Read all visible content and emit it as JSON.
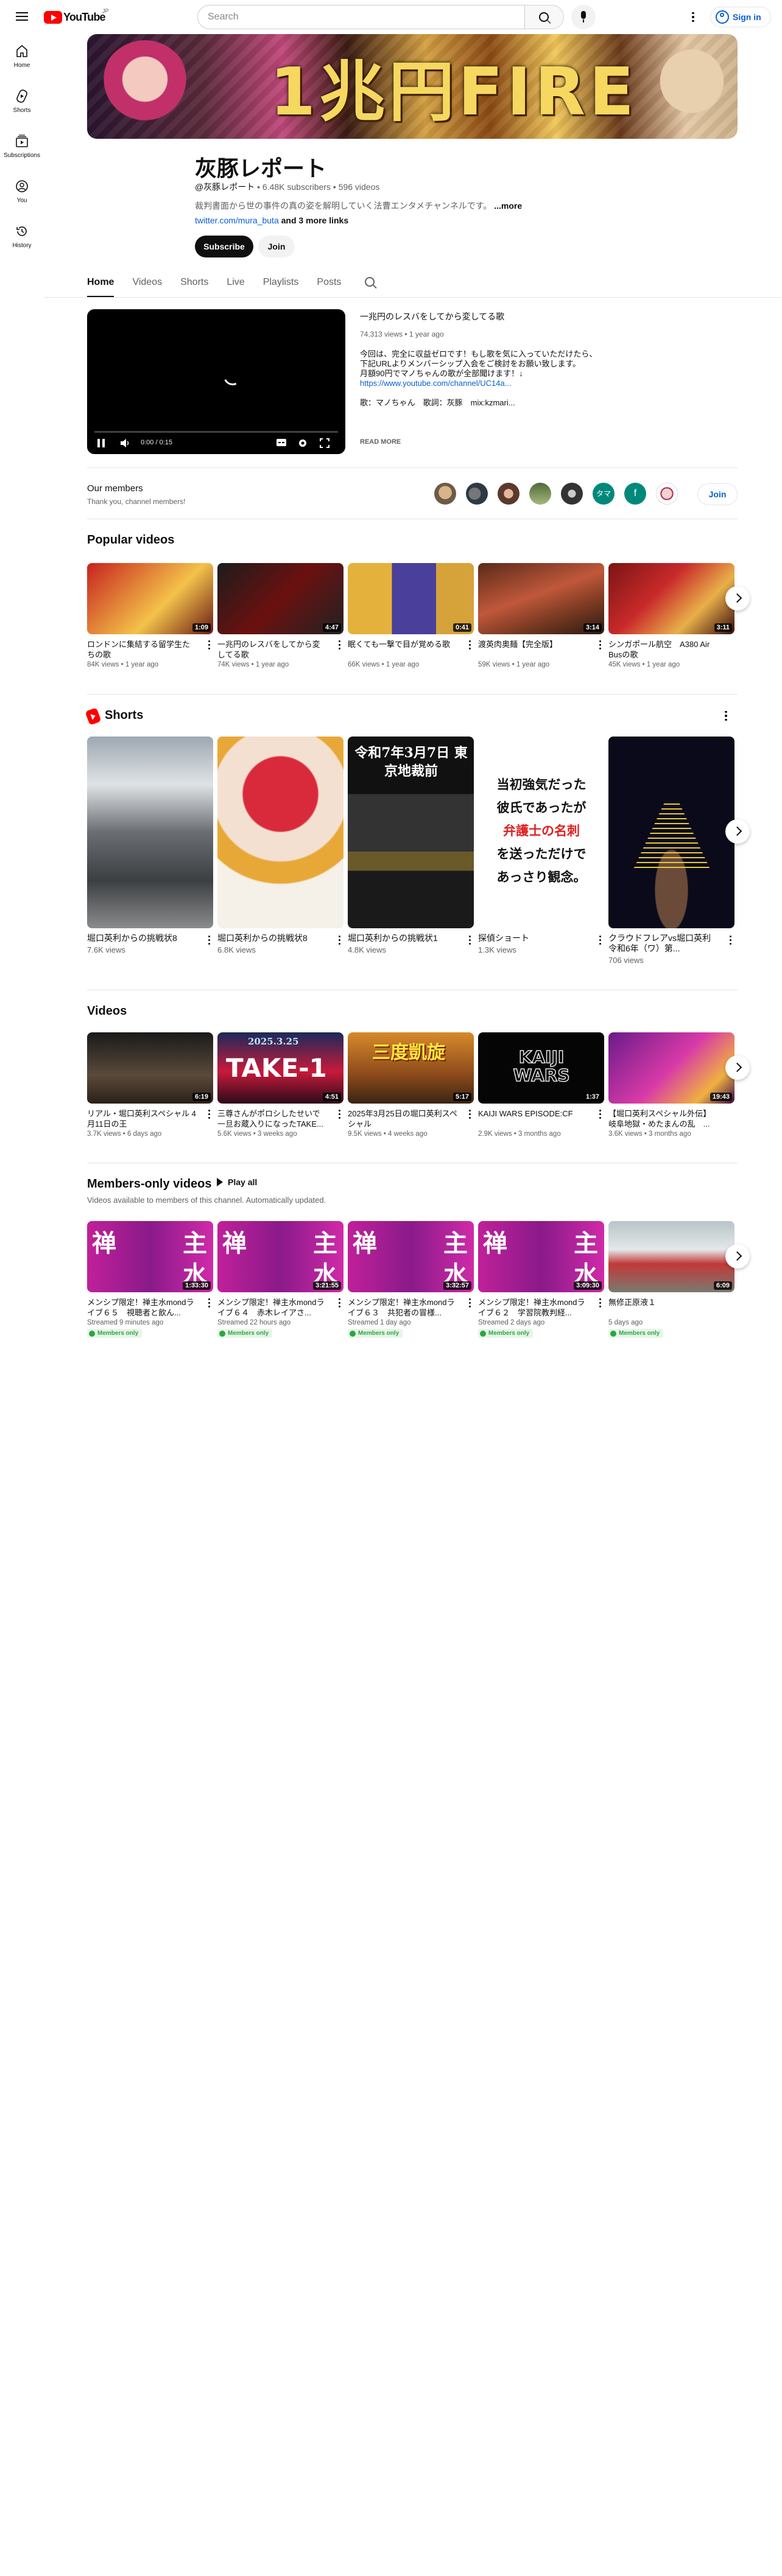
{
  "masthead": {
    "logo_text": "YouTube",
    "logo_sup": "JP",
    "search_placeholder": "Search",
    "sign_in": "Sign in"
  },
  "guide": [
    {
      "label": "Home",
      "icon": "home-icon"
    },
    {
      "label": "Shorts",
      "icon": "shorts-icon"
    },
    {
      "label": "Subscriptions",
      "icon": "subscriptions-icon"
    },
    {
      "label": "You",
      "icon": "you-icon"
    },
    {
      "label": "History",
      "icon": "history-icon"
    }
  ],
  "banner": {
    "text": "1兆円FIRE"
  },
  "channel": {
    "title": "灰豚レポート",
    "handle": "@灰豚レポート",
    "subscribers": "6.48K subscribers",
    "videos": "596 videos",
    "description": "裁判書面から世の事件の真の姿を解明していく法曹エンタメチャンネルです。",
    "more": "...more",
    "link": "twitter.com/mura_buta",
    "more_links": "and 3 more links",
    "subscribe": "Subscribe",
    "join": "Join"
  },
  "tabs": [
    "Home",
    "Videos",
    "Shorts",
    "Live",
    "Playlists",
    "Posts"
  ],
  "featured": {
    "title": "一兆円のレスバをしてから変してる歌",
    "meta": "74,313 views • 1 year ago",
    "desc_lines": [
      "今回は、完全に収益ゼロです！もし歌を気に入っていただけたら、",
      "下記URLよりメンバーシップ入会をご検討をお願い致します。",
      "月額90円でマノちゃんの歌が全部聞けます！↓"
    ],
    "desc_link": "https://www.youtube.com/channel/UC14a...",
    "credits": "歌：マノちゃん　歌詞：灰豚　mix:kzmari...",
    "read_more": "READ MORE",
    "time": "0:00 / 0:15"
  },
  "members": {
    "title": "Our members",
    "subtitle": "Thank you, channel members!",
    "join": "Join",
    "avatar_letters": [
      "タマ",
      "f"
    ]
  },
  "popular": {
    "title": "Popular videos",
    "items": [
      {
        "title": "ロンドンに集結する留学生たちの歌",
        "meta": "84K views • 1 year ago",
        "duration": "1:09"
      },
      {
        "title": "一兆円のレスバをしてから変してる歌",
        "meta": "74K views • 1 year ago",
        "duration": "4:47"
      },
      {
        "title": "眠くても一撃で目が覚める歌",
        "meta": "66K views • 1 year ago",
        "duration": "0:41"
      },
      {
        "title": "渡英肉奥麺【完全版】",
        "meta": "59K views • 1 year ago",
        "duration": "3:14"
      },
      {
        "title": "シンガポール航空　A380 Air Busの歌",
        "meta": "45K views • 1 year ago",
        "duration": "3:11"
      }
    ]
  },
  "shorts": {
    "title": "Shorts",
    "items": [
      {
        "title": "堀口英利からの挑戦状8",
        "views": "7.6K views"
      },
      {
        "title": "堀口英利からの挑戦状8",
        "views": "6.8K views"
      },
      {
        "title": "堀口英利からの挑戦状1",
        "views": "4.8K views"
      },
      {
        "title": "探偵ショート",
        "views": "1.3K views"
      },
      {
        "title": "クラウドフレアvs堀口英利令和6年（ワ）第...",
        "views": "706 views"
      }
    ],
    "thumb3_text": "令和7年3月7日 東京地裁前",
    "thumb4_lines": [
      "当初強気だった",
      "彼氏であったが",
      "弁護士の名刺",
      "を送っただけで",
      "あっさり観念。"
    ]
  },
  "videos": {
    "title": "Videos",
    "items": [
      {
        "title": "リアル・堀口英利スペシャル 4月11日の王",
        "meta": "3.7K views • 6 days ago",
        "duration": "6:19"
      },
      {
        "title": "三尊さんがポロシしたせいで一旦お蔵入りになったTAKE...",
        "meta": "5.6K views • 3 weeks ago",
        "duration": "4:51"
      },
      {
        "title": "2025年3月25日の堀口英利スペシャル",
        "meta": "9.5K views • 4 weeks ago",
        "duration": "5:17"
      },
      {
        "title": "KAIJI WARS EPISODE:CF",
        "meta": "2.9K views • 3 months ago",
        "duration": "1:37"
      },
      {
        "title": "【堀口英利スペシャル外伝】岐阜地獄・めたまんの乱　...",
        "meta": "3.6K views • 3 months ago",
        "duration": "19:43"
      }
    ],
    "thumb2_text": "TAKE-1",
    "thumb2_date": "2025.3.25",
    "thumb3_text": "三度凱旋",
    "thumb4_text": "KAIJI WARS"
  },
  "members_videos": {
    "title": "Members-only videos",
    "play_all": "Play all",
    "subtitle": "Videos available to members of this channel. Automatically updated.",
    "badge": "Members only",
    "items": [
      {
        "title": "メンシプ限定！禅主水mondライブ６５　視聴者と飲ん...",
        "meta": "Streamed 9 minutes ago",
        "duration": "1:33:30"
      },
      {
        "title": "メンシプ限定！禅主水mondライブ６４　赤木レイアさ...",
        "meta": "Streamed 22 hours ago",
        "duration": "3:21:55"
      },
      {
        "title": "メンシプ限定！禅主水mondライブ６３　共犯者の冒様...",
        "meta": "Streamed 1 day ago",
        "duration": "3:32:57"
      },
      {
        "title": "メンシプ限定！禅主水mondライブ６２　学習院教判経...",
        "meta": "Streamed 2 days ago",
        "duration": "3:09:30"
      },
      {
        "title": "無修正原液１",
        "meta": "5 days ago",
        "duration": "6:09"
      }
    ],
    "thumb_chars": [
      "禅",
      "主",
      "水"
    ]
  },
  "colors": {
    "accent_red": "#ff0000",
    "link_blue": "#065fd4",
    "members_green": "#2ba640"
  }
}
